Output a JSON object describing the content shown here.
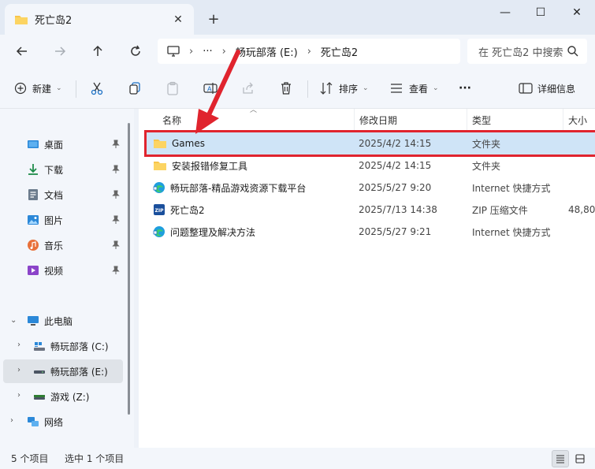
{
  "window": {
    "tab_title": "死亡岛2",
    "tab_close": "✕",
    "new_tab": "+",
    "minimize": "—",
    "maximize": "☐",
    "close": "✕"
  },
  "address": {
    "overflow": "···",
    "crumbs": [
      "畅玩部落 (E:)",
      "死亡岛2"
    ],
    "search_placeholder": "在 死亡岛2 中搜索"
  },
  "command_bar": {
    "new_label": "新建",
    "sort_label": "排序",
    "view_label": "查看",
    "more_label": "···",
    "details_label": "详细信息"
  },
  "sidebar": {
    "quick_access": [
      {
        "label": "桌面",
        "icon": "desktop-icon"
      },
      {
        "label": "下载",
        "icon": "download-icon"
      },
      {
        "label": "文档",
        "icon": "document-icon"
      },
      {
        "label": "图片",
        "icon": "pictures-icon"
      },
      {
        "label": "音乐",
        "icon": "music-icon"
      },
      {
        "label": "视频",
        "icon": "video-icon"
      }
    ],
    "this_pc": "此电脑",
    "drives": [
      {
        "label": "畅玩部落 (C:)",
        "icon": "system-drive-icon"
      },
      {
        "label": "畅玩部落 (E:)",
        "icon": "drive-icon",
        "selected": true
      },
      {
        "label": "游戏 (Z:)",
        "icon": "drive-icon"
      }
    ],
    "network": "网络"
  },
  "columns": {
    "name": "名称",
    "date": "修改日期",
    "type": "类型",
    "size": "大小"
  },
  "files": [
    {
      "name": "Games",
      "date": "2025/4/2 14:15",
      "type": "文件夹",
      "size": "",
      "icon": "folder-icon",
      "selected": true
    },
    {
      "name": "安装报错修复工具",
      "date": "2025/4/2 14:15",
      "type": "文件夹",
      "size": "",
      "icon": "folder-icon"
    },
    {
      "name": "畅玩部落-精品游戏资源下载平台",
      "date": "2025/5/27 9:20",
      "type": "Internet 快捷方式",
      "size": "",
      "icon": "edge-shortcut-icon"
    },
    {
      "name": "死亡岛2",
      "date": "2025/7/13 14:38",
      "type": "ZIP 压缩文件",
      "size": "48,80",
      "icon": "zip-icon"
    },
    {
      "name": "问题整理及解决方法",
      "date": "2025/5/27 9:21",
      "type": "Internet 快捷方式",
      "size": "",
      "icon": "edge-shortcut-icon"
    }
  ],
  "status": {
    "item_count": "5 个项目",
    "selected_count": "选中 1 个项目"
  },
  "colors": {
    "accent": "#0067c0",
    "folder": "#f8c54a",
    "highlight_box": "#e0242e",
    "selected_row": "#cfe4f7"
  }
}
